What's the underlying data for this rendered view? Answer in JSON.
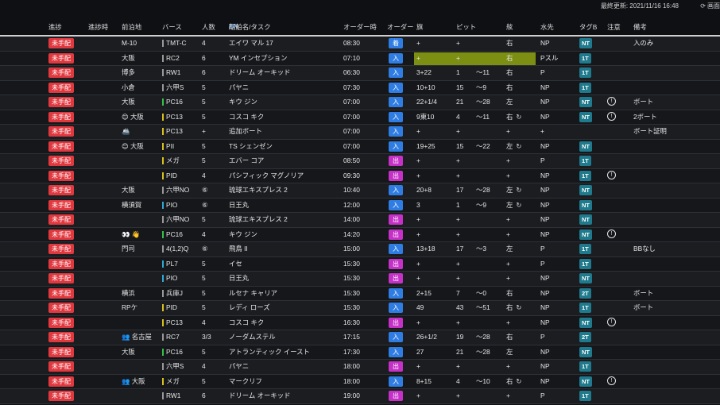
{
  "top": {
    "updated": "最終更新: 2021/11/16 16:48",
    "refresh_label": "画面"
  },
  "headers": {
    "status": "進捗",
    "progress_time": "進捗時",
    "prev_port": "前泊地",
    "berth": "バース",
    "people": "人数",
    "ship_task_prefix": "船舶名/タスク",
    "lang_jp": "JP",
    "lang_sep": "/",
    "lang_en": "EN",
    "order_time": "オーダー時",
    "order": "オーダー",
    "flag": "旗",
    "pit": "ピット",
    "side": "舷",
    "water": "水先",
    "tag": "タグB",
    "caution": "注意",
    "remarks": "備考"
  },
  "rows": [
    {
      "status": "未手配",
      "prev": "M-10",
      "berth": "TMT-C",
      "bc": "#9a9a9a",
      "people": "4",
      "ship": "エイワ マル 17",
      "time": "08:30",
      "order": "着",
      "oc": "o-blue",
      "flag": "+",
      "pit": "+",
      "range": "",
      "side": "右",
      "water": "NP",
      "tag": "NT",
      "note": false,
      "remark": "入のみ"
    },
    {
      "status": "未手配",
      "prev": "大阪",
      "berth": "RC2",
      "bc": "#9a9a9a",
      "people": "6",
      "ship": "YM インセプション",
      "time": "07:10",
      "order": "入",
      "oc": "o-blue",
      "flag": "+",
      "pit": "+",
      "range": "",
      "side": "右",
      "water": "Pスル",
      "tag": "1T",
      "note": false,
      "remark": "",
      "hl": true
    },
    {
      "status": "未手配",
      "prev": "博多",
      "berth": "RW1",
      "bc": "#9a9a9a",
      "people": "6",
      "ship": "ドリーム オーキッド",
      "time": "06:30",
      "order": "入",
      "oc": "o-blue",
      "flag": "3+22",
      "pit": "1",
      "range": "〜11",
      "side": "右",
      "water": "P",
      "tag": "1T",
      "note": false,
      "remark": ""
    },
    {
      "status": "未手配",
      "prev": "小倉",
      "berth": "六甲S",
      "bc": "#9a9a9a",
      "people": "5",
      "ship": "パヤニ",
      "time": "07:30",
      "order": "入",
      "oc": "o-blue",
      "flag": "10+10",
      "pit": "15",
      "range": "〜9",
      "side": "右",
      "water": "NP",
      "tag": "1T",
      "note": false,
      "remark": ""
    },
    {
      "status": "未手配",
      "prev": "大阪",
      "berth": "PC16",
      "bc": "#35c24a",
      "people": "5",
      "ship": "キウ ジン",
      "time": "07:00",
      "order": "入",
      "oc": "o-blue",
      "flag": "22+1/4",
      "pit": "21",
      "range": "〜28",
      "side": "左",
      "water": "NP",
      "tag": "NT",
      "note": true,
      "remark": "ボート"
    },
    {
      "status": "未手配",
      "prev": "😊 大阪",
      "berth": "PC13",
      "bc": "#d9c21a",
      "people": "5",
      "ship": "コスコ キク",
      "time": "07:00",
      "order": "入",
      "oc": "o-blue",
      "flag": "9東10",
      "pit": "4",
      "range": "〜11",
      "side": "右",
      "cyc": "↻",
      "water": "NP",
      "tag": "NT",
      "note": true,
      "remark": "2ボート"
    },
    {
      "status": "未手配",
      "prev": "🚢",
      "berth": "PC13",
      "bc": "#d9c21a",
      "people": "+",
      "ship": "追加ボート",
      "time": "07:00",
      "order": "入",
      "oc": "o-blue",
      "flag": "+",
      "pit": "+",
      "range": "",
      "side": "+",
      "water": "+",
      "tag": "",
      "note": false,
      "remark": "ボート証明"
    },
    {
      "status": "未手配",
      "prev": "😊 大阪",
      "berth": "PII",
      "bc": "#d9c21a",
      "people": "5",
      "ship": "TS シェンゼン",
      "time": "07:00",
      "order": "入",
      "oc": "o-blue",
      "flag": "19+25",
      "pit": "15",
      "range": "〜22",
      "side": "左",
      "cyc": "↻",
      "water": "NP",
      "tag": "NT",
      "note": false,
      "remark": ""
    },
    {
      "status": "未手配",
      "prev": "",
      "berth": "メガ",
      "bc": "#d9c21a",
      "people": "5",
      "ship": "エバー コア",
      "time": "08:50",
      "order": "出",
      "oc": "o-pink",
      "flag": "+",
      "pit": "+",
      "range": "",
      "side": "+",
      "water": "P",
      "tag": "1T",
      "note": false,
      "remark": ""
    },
    {
      "status": "未手配",
      "prev": "",
      "berth": "PID",
      "bc": "#d9c21a",
      "people": "4",
      "ship": "パシフィック マグノリア",
      "time": "09:30",
      "order": "出",
      "oc": "o-pink",
      "flag": "+",
      "pit": "+",
      "range": "",
      "side": "+",
      "water": "NP",
      "tag": "1T",
      "note": true,
      "remark": ""
    },
    {
      "status": "未手配",
      "prev": "大阪",
      "berth": "六甲NO",
      "bc": "#9a9a9a",
      "people": "⑥",
      "ship": "琉球エキスプレス 2",
      "time": "10:40",
      "order": "入",
      "oc": "o-blue",
      "flag": "20+8",
      "pit": "17",
      "range": "〜28",
      "side": "左",
      "cyc": "↻",
      "water": "NP",
      "tag": "NT",
      "note": false,
      "remark": ""
    },
    {
      "status": "未手配",
      "prev": "横須賀",
      "berth": "PIO",
      "bc": "#2fa8d8",
      "people": "⑥",
      "ship": "日王丸",
      "time": "12:00",
      "order": "入",
      "oc": "o-blue",
      "flag": "3",
      "pit": "1",
      "range": "〜9",
      "side": "左",
      "cyc": "↻",
      "water": "NP",
      "tag": "NT",
      "note": false,
      "remark": ""
    },
    {
      "status": "未手配",
      "prev": "",
      "berth": "六甲NO",
      "bc": "#9a9a9a",
      "people": "5",
      "ship": "琉球エキスプレス 2",
      "time": "14:00",
      "order": "出",
      "oc": "o-pink",
      "flag": "+",
      "pit": "+",
      "range": "",
      "side": "+",
      "water": "NP",
      "tag": "NT",
      "note": false,
      "remark": ""
    },
    {
      "status": "未手配",
      "prev": "👀 👋",
      "berth": "PC16",
      "bc": "#35c24a",
      "people": "4",
      "ship": "キウ ジン",
      "time": "14:20",
      "order": "出",
      "oc": "o-pink",
      "flag": "+",
      "pit": "+",
      "range": "",
      "side": "+",
      "water": "NP",
      "tag": "NT",
      "note": true,
      "remark": ""
    },
    {
      "status": "未手配",
      "prev": "門司",
      "berth": "4(1,2)Q",
      "bc": "#9a9a9a",
      "people": "⑥",
      "ship": "飛鳥 II",
      "time": "15:00",
      "order": "入",
      "oc": "o-blue",
      "flag": "13+18",
      "pit": "17",
      "range": "〜3",
      "side": "左",
      "water": "P",
      "tag": "1T",
      "note": false,
      "remark": "BBなし"
    },
    {
      "status": "未手配",
      "prev": "",
      "berth": "PL7",
      "bc": "#2fa8d8",
      "people": "5",
      "ship": "イセ",
      "time": "15:30",
      "order": "出",
      "oc": "o-pink",
      "flag": "+",
      "pit": "+",
      "range": "",
      "side": "+",
      "water": "P",
      "tag": "1T",
      "note": false,
      "remark": ""
    },
    {
      "status": "未手配",
      "prev": "",
      "berth": "PIO",
      "bc": "#2fa8d8",
      "people": "5",
      "ship": "日王丸",
      "time": "15:30",
      "order": "出",
      "oc": "o-pink",
      "flag": "+",
      "pit": "+",
      "range": "",
      "side": "+",
      "water": "NP",
      "tag": "NT",
      "note": false,
      "remark": ""
    },
    {
      "status": "未手配",
      "prev": "横浜",
      "berth": "兵庫J",
      "bc": "#9a9a9a",
      "people": "5",
      "ship": "ルセナ キャリア",
      "time": "15:30",
      "order": "入",
      "oc": "o-blue",
      "flag": "2+15",
      "pit": "7",
      "range": "〜0",
      "side": "右",
      "water": "NP",
      "tag": "2T",
      "note": false,
      "remark": "ボート"
    },
    {
      "status": "未手配",
      "prev": "RPケ",
      "berth": "PID",
      "bc": "#d9c21a",
      "people": "5",
      "ship": "レディ ローズ",
      "time": "15:30",
      "order": "入",
      "oc": "o-blue",
      "flag": "49",
      "pit": "43",
      "range": "〜51",
      "side": "右",
      "cyc": "↻",
      "water": "NP",
      "tag": "1T",
      "note": false,
      "remark": "ボート"
    },
    {
      "status": "未手配",
      "prev": "",
      "berth": "PC13",
      "bc": "#d9c21a",
      "people": "4",
      "ship": "コスコ キク",
      "time": "16:30",
      "order": "出",
      "oc": "o-pink",
      "flag": "+",
      "pit": "+",
      "range": "",
      "side": "+",
      "water": "NP",
      "tag": "NT",
      "note": true,
      "remark": ""
    },
    {
      "status": "未手配",
      "prev": "👥 名古屋",
      "berth": "RC7",
      "bc": "#9a9a9a",
      "people": "3/3",
      "ship": "ノーダムステル",
      "time": "17:15",
      "order": "入",
      "oc": "o-blue",
      "flag": "26+1/2",
      "pit": "19",
      "range": "〜28",
      "side": "右",
      "water": "P",
      "tag": "2T",
      "note": false,
      "remark": ""
    },
    {
      "status": "未手配",
      "prev": "大阪",
      "berth": "PC16",
      "bc": "#35c24a",
      "people": "5",
      "ship": "アトランティック イースト",
      "time": "17:30",
      "order": "入",
      "oc": "o-blue",
      "flag": "27",
      "pit": "21",
      "range": "〜28",
      "side": "左",
      "water": "NP",
      "tag": "NT",
      "note": false,
      "remark": ""
    },
    {
      "status": "未手配",
      "prev": "",
      "berth": "六甲S",
      "bc": "#9a9a9a",
      "people": "4",
      "ship": "パヤニ",
      "time": "18:00",
      "order": "出",
      "oc": "o-pink",
      "flag": "+",
      "pit": "+",
      "range": "",
      "side": "+",
      "water": "NP",
      "tag": "1T",
      "note": false,
      "remark": ""
    },
    {
      "status": "未手配",
      "prev": "👥 大阪",
      "berth": "メガ",
      "bc": "#d9c21a",
      "people": "5",
      "ship": "マークリフ",
      "time": "18:00",
      "order": "入",
      "oc": "o-blue",
      "flag": "8+15",
      "pit": "4",
      "range": "〜10",
      "side": "右",
      "cyc": "↻",
      "water": "NP",
      "tag": "NT",
      "note": true,
      "remark": ""
    },
    {
      "status": "未手配",
      "prev": "",
      "berth": "RW1",
      "bc": "#9a9a9a",
      "people": "6",
      "ship": "ドリーム オーキッド",
      "time": "19:00",
      "order": "出",
      "oc": "o-pink",
      "flag": "+",
      "pit": "+",
      "range": "",
      "side": "+",
      "water": "P",
      "tag": "1T",
      "note": false,
      "remark": ""
    }
  ]
}
